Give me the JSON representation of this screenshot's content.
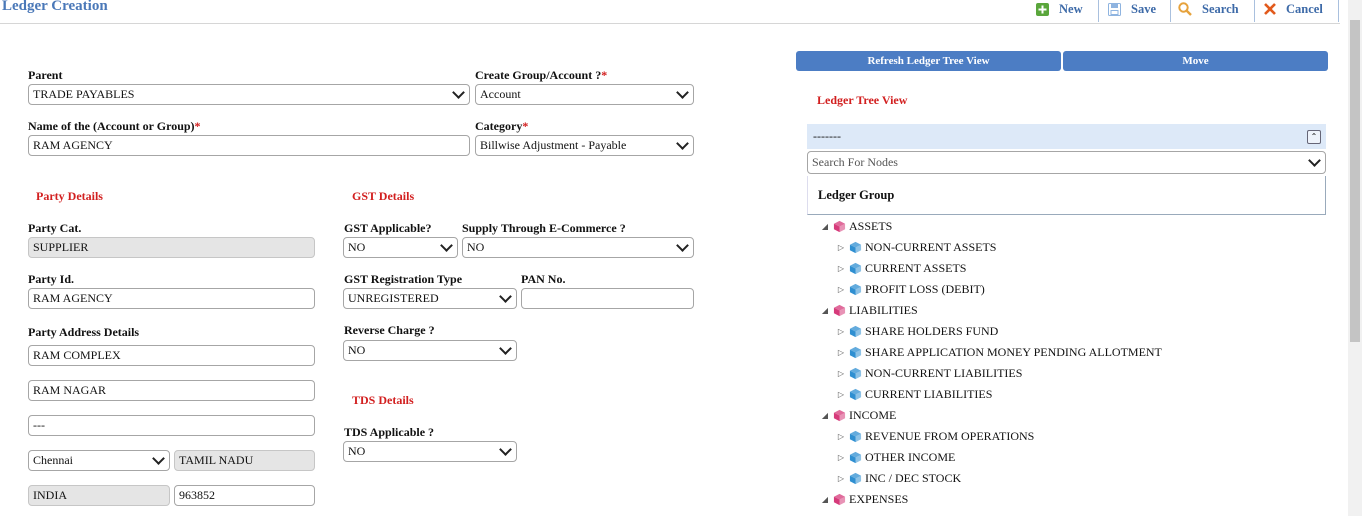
{
  "page": {
    "title": "Ledger Creation"
  },
  "toolbar": {
    "new": "New",
    "save": "Save",
    "search": "Search",
    "cancel": "Cancel"
  },
  "form": {
    "parent": {
      "label": "Parent",
      "value": "TRADE PAYABLES"
    },
    "create_type": {
      "label": "Create Group/Account ?",
      "required": "*",
      "value": "Account"
    },
    "name": {
      "label": "Name of the (Account or Group)",
      "required": "*",
      "value": "RAM AGENCY"
    },
    "category": {
      "label": "Category",
      "required": "*",
      "value": "Billwise Adjustment - Payable"
    }
  },
  "party": {
    "heading": "Party Details",
    "cat_label": "Party Cat.",
    "cat_value": "SUPPLIER",
    "id_label": "Party Id.",
    "id_value": "RAM AGENCY",
    "address_label": "Party Address Details",
    "address1": "RAM COMPLEX",
    "address2": "RAM NAGAR",
    "address3": "---",
    "city": "Chennai",
    "state": "TAMIL NADU",
    "country": "INDIA",
    "pincode": "963852"
  },
  "gst": {
    "heading": "GST Details",
    "applicable_label": "GST Applicable?",
    "applicable_value": "NO",
    "ecommerce_label": "Supply Through E-Commerce ?",
    "ecommerce_value": "NO",
    "reg_type_label": "GST Registration Type",
    "reg_type_value": "UNREGISTERED",
    "pan_label": "PAN No.",
    "pan_value": "",
    "reverse_label": "Reverse Charge ?",
    "reverse_value": "NO"
  },
  "tds": {
    "heading": "TDS Details",
    "applicable_label": "TDS Applicable ?",
    "applicable_value": "NO"
  },
  "tree": {
    "refresh_btn": "Refresh Ledger Tree View",
    "move_btn": "Move",
    "heading": "Ledger Tree View",
    "selected": "-------",
    "search_placeholder": "Search For Nodes",
    "group_label": "Ledger Group",
    "nodes": [
      {
        "label": "ASSETS",
        "level": 0
      },
      {
        "label": "NON-CURRENT ASSETS",
        "level": 1
      },
      {
        "label": "CURRENT ASSETS",
        "level": 1
      },
      {
        "label": "PROFIT LOSS (DEBIT)",
        "level": 1
      },
      {
        "label": "LIABILITIES",
        "level": 0
      },
      {
        "label": "SHARE HOLDERS FUND",
        "level": 1
      },
      {
        "label": "SHARE APPLICATION MONEY PENDING ALLOTMENT",
        "level": 1
      },
      {
        "label": "NON-CURRENT LIABILITIES",
        "level": 1
      },
      {
        "label": "CURRENT LIABILITIES",
        "level": 1
      },
      {
        "label": "INCOME",
        "level": 0
      },
      {
        "label": "REVENUE FROM OPERATIONS",
        "level": 1
      },
      {
        "label": "OTHER INCOME",
        "level": 1
      },
      {
        "label": "INC / DEC STOCK",
        "level": 1
      },
      {
        "label": "EXPENSES",
        "level": 0
      }
    ]
  },
  "colors": {
    "accent": "#4c7dc4",
    "title": "#4a78b8",
    "required": "#d21f1f",
    "root_cube": "#d63a7a",
    "child_cube": "#2f8fd1"
  }
}
